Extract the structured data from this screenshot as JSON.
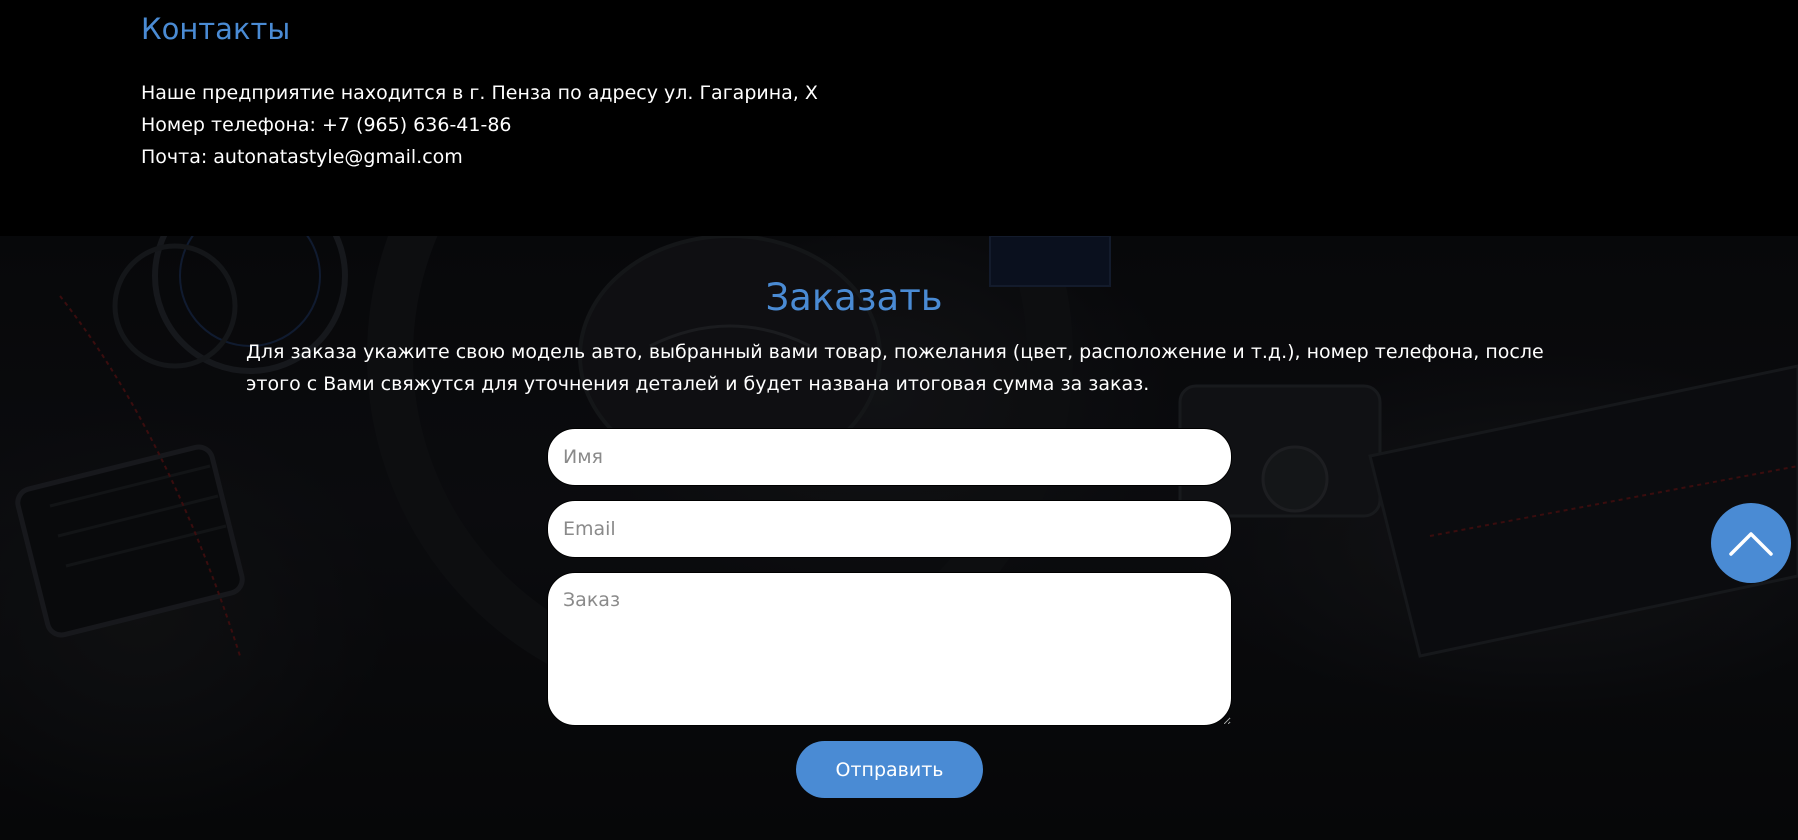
{
  "contacts": {
    "title": "Контакты",
    "address": "Наше предприятие находится в г. Пенза по адресу ул. Гагарина, Х",
    "phone": "Номер телефона: +7 (965) 636-41-86",
    "email": "Почта: autonatastyle@gmail.com"
  },
  "order": {
    "title": "Заказать",
    "description": "Для заказа укажите свою модель авто, выбранный вами товар, пожелания (цвет, расположение и т.д.), номер телефона, после этого с Вами свяжутся для уточнения деталей и будет названа итоговая сумма за заказ.",
    "name_placeholder": "Имя",
    "email_placeholder": "Email",
    "order_placeholder": "Заказ",
    "submit_label": "Отправить"
  },
  "scroll_top": {
    "icon": "chevron-up-icon"
  },
  "colors": {
    "accent": "#4a8bd4",
    "background": "#000000",
    "text": "#ffffff"
  }
}
